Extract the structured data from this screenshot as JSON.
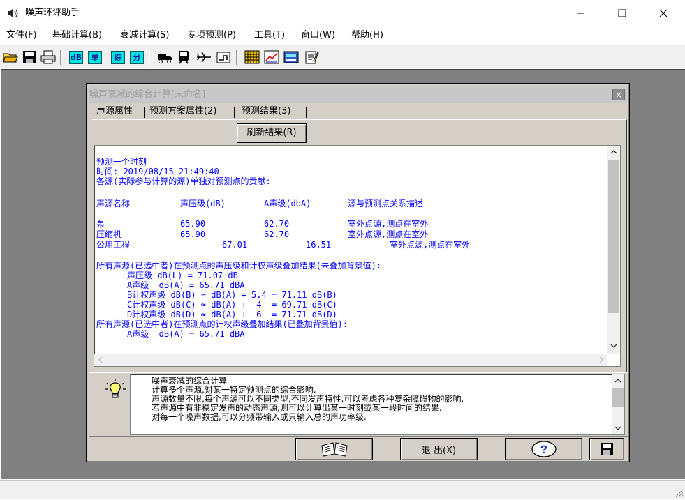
{
  "window": {
    "title": "噪声环评助手",
    "minimize_label": "—",
    "maximize_label": "☐",
    "close_label": "✕"
  },
  "menu": [
    {
      "label": "文件(F)"
    },
    {
      "label": "基础计算(B)"
    },
    {
      "label": "衰减计算(S)"
    },
    {
      "label": "专项预测(P)"
    },
    {
      "label": "工具(T)"
    },
    {
      "label": "窗口(W)"
    },
    {
      "label": "帮助(H)"
    }
  ],
  "toolbar": {
    "chips": [
      "dB",
      "单",
      "综",
      "分"
    ]
  },
  "dialog": {
    "title": "噪声衰减的综合计算[未命名]",
    "close_label": "×",
    "tabs": [
      {
        "label": "声源属性"
      },
      {
        "label": "预测方案属性(2)"
      },
      {
        "label": "预测结果(3)",
        "selected": true
      }
    ],
    "refresh_label": "刷新结果(R)",
    "result": {
      "header1": "预测一个时刻",
      "time_line": "时间: 2019/08/15 21:49:40",
      "header2": "各源(实际参与计算的源)单独对预测点的贡献:",
      "columns": [
        "声源名称",
        "声压级(dB)",
        "A声级(dbA)",
        "源与预测点关系描述"
      ],
      "rows": [
        {
          "name": "泵",
          "spl": "65.90",
          "a": "62.70",
          "desc": "室外点源,测点在室外"
        },
        {
          "name": "压缩机",
          "spl": "65.90",
          "a": "62.70",
          "desc": "室外点源,测点在室外"
        },
        {
          "name": "公用工程",
          "spl": "67.01",
          "a": "16.51",
          "desc": "室外点源,测点在室外"
        }
      ],
      "sum_header": "所有声源(已选中者)在预测点的声压级和计权声级叠加结果(未叠加背景值):",
      "sum_lines": [
        "声压级 dB(L) = 71.07 dB",
        "A声级  dB(A) = 65.71 dBA",
        "B计权声级 dB(B) ≈ dB(A) + 5.4 = 71.11 dB(B)",
        "C计权声级 dB(C) ≈ dB(A) +  4  = 69.71 dB(C)",
        "D计权声级 dB(D) ≈ dB(A) +  6  = 71.71 dB(D)"
      ],
      "bg_header": "所有声源(已选中者)在预测点的计权声级叠加结果(已叠加背景值):",
      "bg_line": "A声级  dB(A) = 65.71 dBA"
    },
    "description": [
      "噪声衰减的综合计算",
      "计算多个声源,对某一特定预测点的综合影响.",
      "声源数量不限,每个声源可以不同类型,不同发声特性.可以考虑各种复杂障碍物的影响.",
      "若声源中有非稳定发声的动态声源,则可以计算出某一时刻或某一段时间的结果.",
      "对每一个噪声数据,可以分频带输入或只输入总的声功率级."
    ],
    "exit_label": "退 出(X)"
  }
}
